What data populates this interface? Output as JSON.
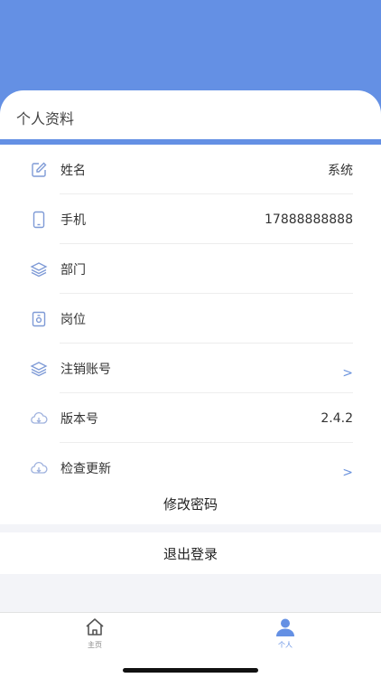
{
  "header": {
    "title": "个人资料"
  },
  "profile": {
    "items": [
      {
        "icon": "edit-icon",
        "label": "姓名",
        "value": "系统",
        "chevron": ""
      },
      {
        "icon": "phone-icon",
        "label": "手机",
        "value": "17888888888",
        "chevron": ""
      },
      {
        "icon": "layers-icon",
        "label": "部门",
        "value": "",
        "chevron": ""
      },
      {
        "icon": "badge-icon",
        "label": "岗位",
        "value": "",
        "chevron": ""
      },
      {
        "icon": "layers-icon",
        "label": "注销账号",
        "value": "",
        "chevron": ">"
      },
      {
        "icon": "cloud-download-icon",
        "label": "版本号",
        "value": "2.4.2",
        "chevron": ""
      },
      {
        "icon": "cloud-download-icon",
        "label": "检查更新",
        "value": "",
        "chevron": ">"
      }
    ]
  },
  "actions": {
    "change_password": "修改密码",
    "logout": "退出登录"
  },
  "tabbar": {
    "tabs": [
      {
        "icon": "home-icon",
        "label": "主页",
        "active": false
      },
      {
        "icon": "user-icon",
        "label": "个人",
        "active": true
      }
    ]
  },
  "colors": {
    "accent": "#6490e4",
    "icon_blue": "#7e9ad6",
    "inactive": "#888888"
  }
}
